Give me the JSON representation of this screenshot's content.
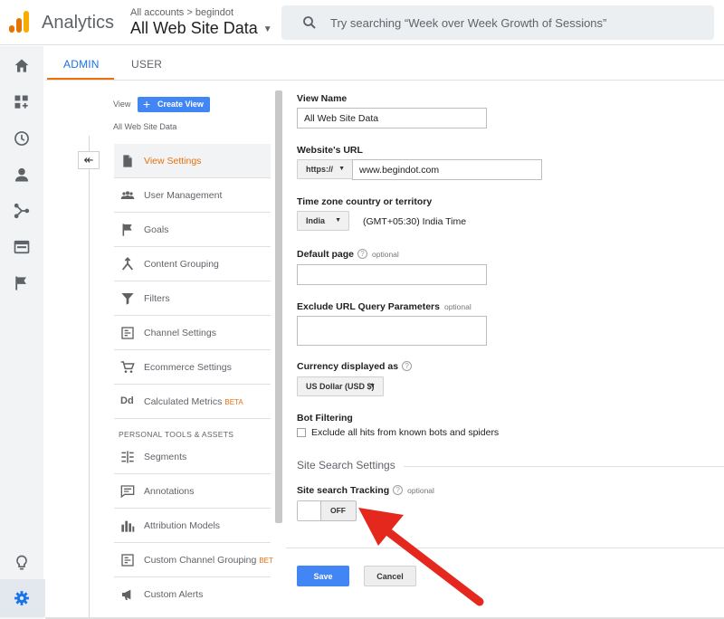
{
  "header": {
    "app_name": "Analytics",
    "breadcrumb_small": "All accounts > begindot",
    "property_name": "All Web Site Data",
    "search_placeholder": "Try searching “Week over Week Growth of Sessions”",
    "logo_colors": [
      "#f9ab00",
      "#e37400",
      "#e37400"
    ]
  },
  "rail": {
    "icons": [
      "home-icon",
      "customization-icon",
      "realtime-icon",
      "audience-icon",
      "acquisition-icon",
      "behavior-icon",
      "conversions-icon",
      "discover-icon",
      "admin-gear-icon"
    ],
    "active_color": "#1a73e8"
  },
  "tabs": {
    "admin": "ADMIN",
    "user": "USER",
    "accent": "#e8710a"
  },
  "view_column": {
    "label": "View",
    "create_button": "Create View",
    "view_name": "All Web Site Data",
    "back_symbol": "↞",
    "items": [
      {
        "label": "View Settings",
        "icon": "document-icon",
        "active": true
      },
      {
        "label": "User Management",
        "icon": "people-icon"
      },
      {
        "label": "Goals",
        "icon": "flag-icon"
      },
      {
        "label": "Content Grouping",
        "icon": "content-grouping-icon"
      },
      {
        "label": "Filters",
        "icon": "filter-icon"
      },
      {
        "label": "Channel Settings",
        "icon": "channel-icon"
      },
      {
        "label": "Ecommerce Settings",
        "icon": "cart-icon"
      },
      {
        "label": "Calculated Metrics",
        "icon": "dd-icon",
        "badge": "BETA",
        "icon_text": "Dd"
      }
    ],
    "section_head": "PERSONAL TOOLS & ASSETS",
    "personal_items": [
      {
        "label": "Segments",
        "icon": "segments-icon"
      },
      {
        "label": "Annotations",
        "icon": "annotations-icon"
      },
      {
        "label": "Attribution Models",
        "icon": "attribution-icon"
      },
      {
        "label": "Custom Channel Grouping",
        "icon": "channel-icon",
        "badge": "BET"
      },
      {
        "label": "Custom Alerts",
        "icon": "megaphone-icon"
      }
    ]
  },
  "form": {
    "view_name_label": "View Name",
    "view_name_value": "All Web Site Data",
    "website_url_label": "Website's URL",
    "protocol": "https://",
    "website_url_value": "www.begindot.com",
    "timezone_label": "Time zone country or territory",
    "country": "India",
    "timezone": "(GMT+05:30) India Time",
    "default_page_label": "Default page",
    "optional": "optional",
    "default_page_value": "",
    "exclude_label": "Exclude URL Query Parameters",
    "exclude_value": "",
    "currency_label": "Currency displayed as",
    "currency_value": "US Dollar (USD $)",
    "bot_label": "Bot Filtering",
    "bot_checkbox_label": "Exclude all hits from known bots and spiders",
    "site_search_title": "Site Search Settings",
    "site_search_label": "Site search Tracking",
    "toggle_state": "OFF",
    "save": "Save",
    "cancel": "Cancel",
    "help_glyph": "?"
  },
  "annotation": {
    "arrow_color": "#e5281e"
  }
}
